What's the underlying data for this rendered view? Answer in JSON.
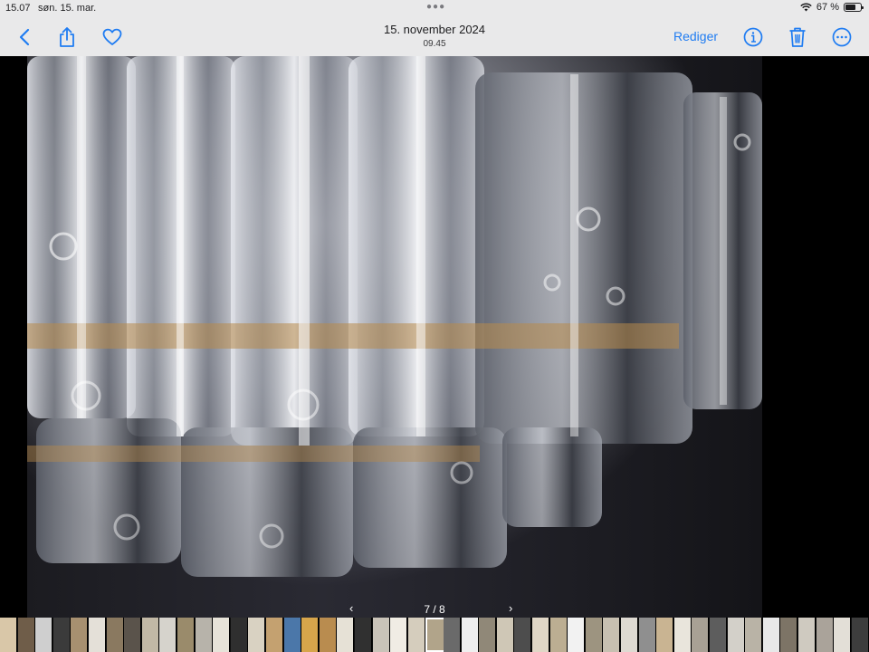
{
  "status_bar": {
    "time": "15.07",
    "date": "søn. 15. mar.",
    "battery_percent": "67 %",
    "battery_level": 0.67
  },
  "nav": {
    "title": "15. november 2024",
    "subtitle": "09.45",
    "edit_label": "Rediger",
    "accent_color": "#1f7cf2",
    "icons": [
      "back-chevron-icon",
      "share-icon",
      "heart-icon",
      "info-icon",
      "trash-icon",
      "more-icon"
    ]
  },
  "pager": {
    "prev_symbol": "‹",
    "count": "7 / 8",
    "next_symbol": "›"
  },
  "filmstrip": {
    "thumb_colors": [
      "#d9c7a8",
      "#6f5d49",
      "#cfcfcf",
      "#3b3b3b",
      "#a79070",
      "#e4e0d8",
      "#8a7960",
      "#5a534b",
      "#c2b9a6",
      "#d6d3cc",
      "#9a8b6b",
      "#b7b3aa",
      "#e7e3d9",
      "#2f2f2f",
      "#d9d2c2",
      "#c4a170",
      "#4b77a9",
      "#d7a54b",
      "#b98c4f",
      "#e6e1d6",
      "#303030",
      "#c9c3b8",
      "#f0ece4",
      "#d5cdbd",
      "#b1a48a",
      "#6a6a6a",
      "#efefef",
      "#908878",
      "#cfc7b6",
      "#4d4d4d",
      "#e0d7c6",
      "#bcae92",
      "#f2f2f2",
      "#9d9480",
      "#c7c0b1",
      "#dedad2",
      "#8f8f8f",
      "#c9b492",
      "#e9e5dc",
      "#a8a195",
      "#5d5d5d",
      "#d3d0c9",
      "#b9b3a6",
      "#e8e8e8",
      "#7d7466",
      "#cfcac0",
      "#aaa39a",
      "#e3dfd7",
      "#3d3d3d"
    ],
    "current_index": 24
  }
}
